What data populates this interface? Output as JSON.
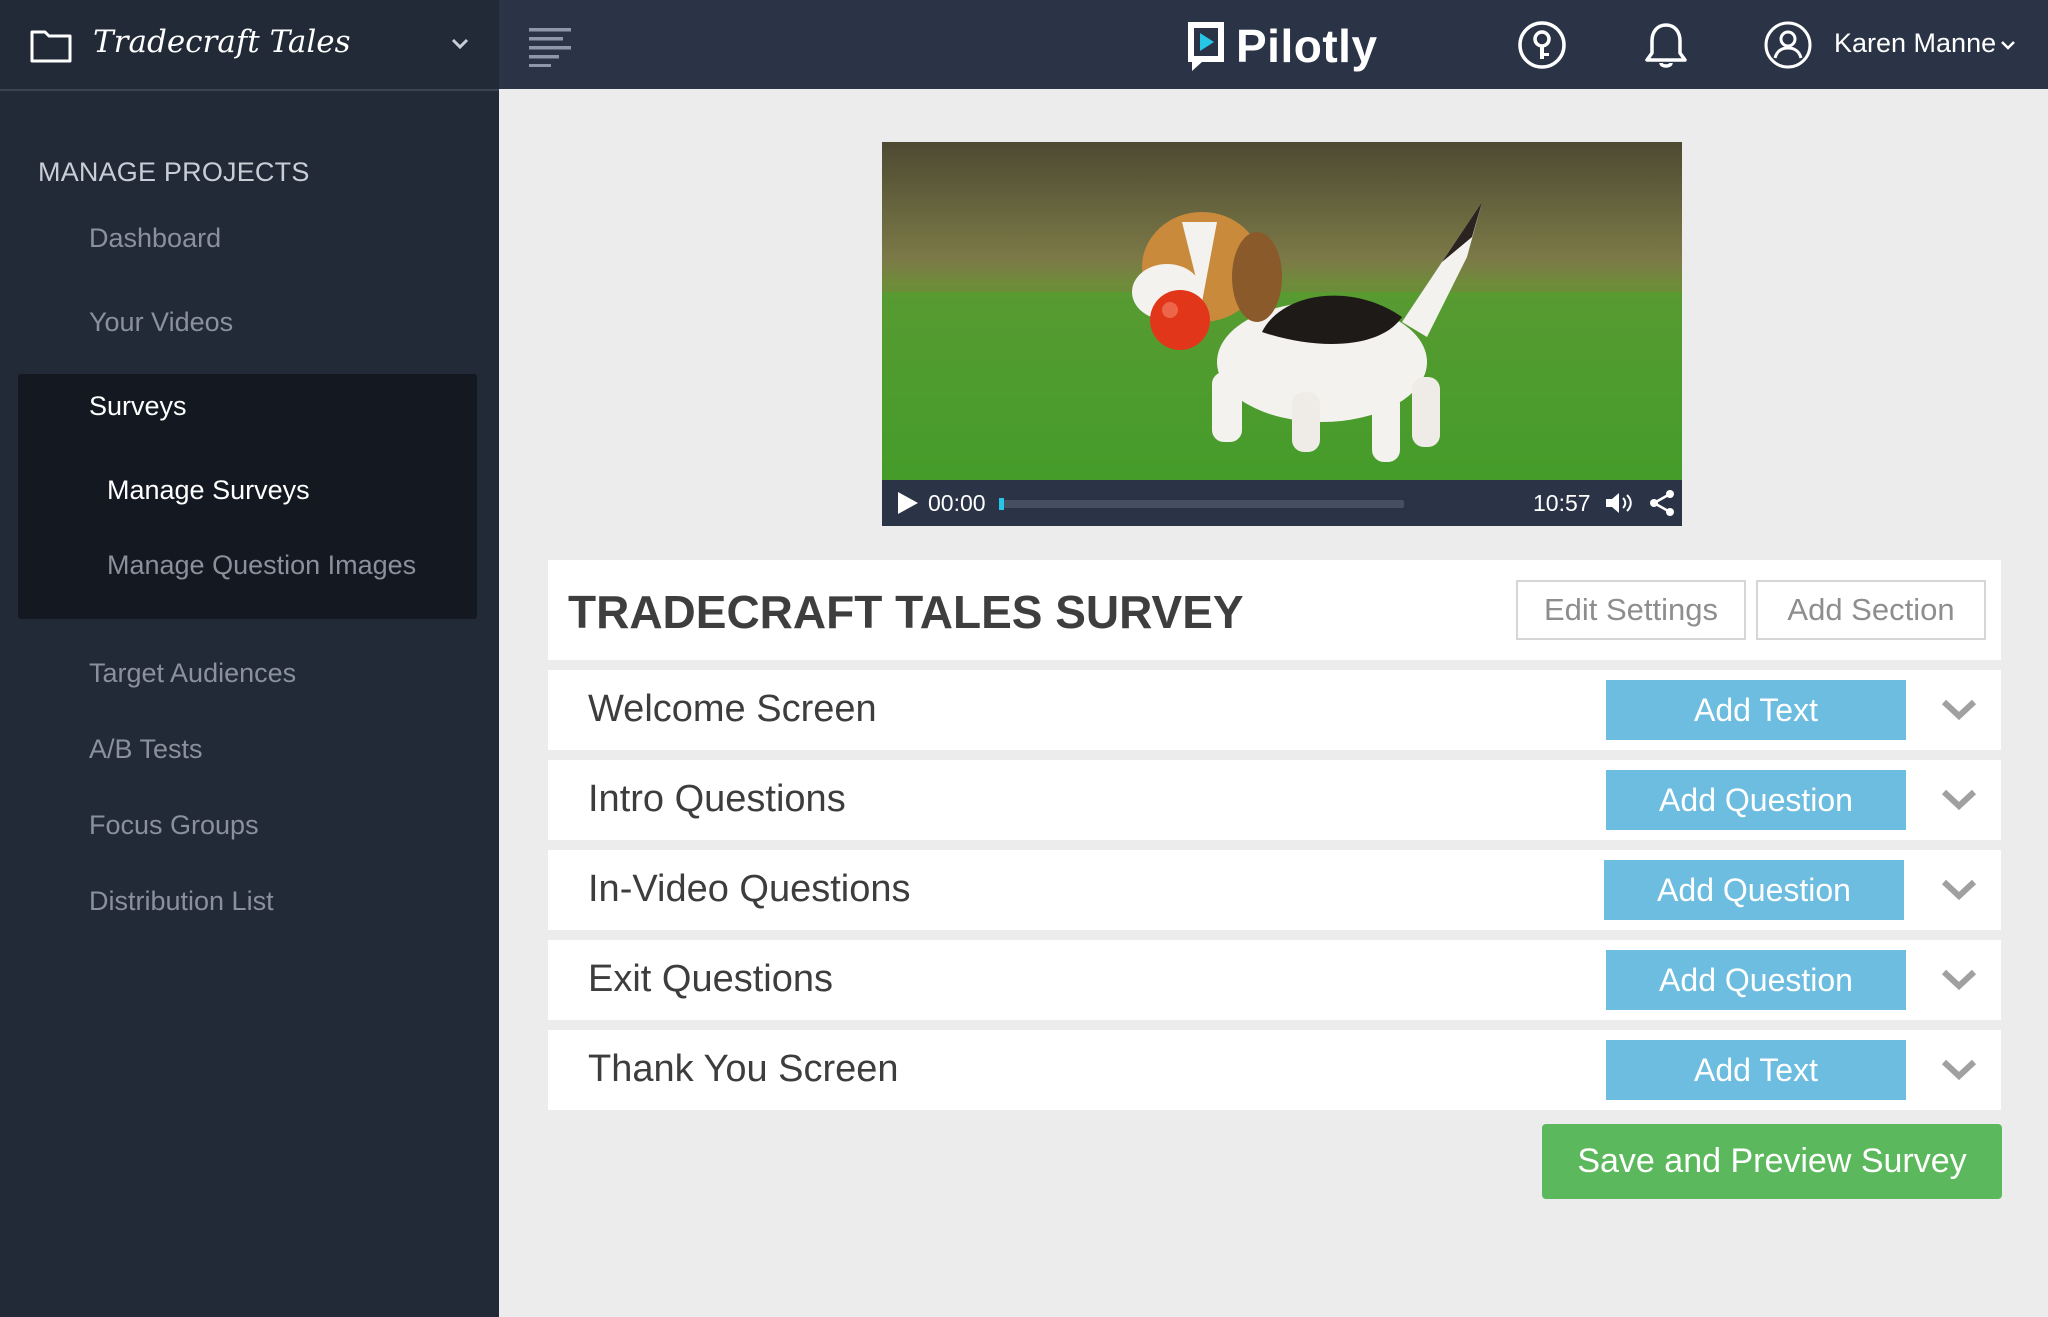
{
  "sidebar": {
    "project_name": "Tradecraft Tales",
    "section_heading": "MANAGE PROJECTS",
    "items": [
      {
        "label": "Dashboard"
      },
      {
        "label": "Your Videos"
      },
      {
        "label": "Surveys"
      },
      {
        "label": "Manage Surveys"
      },
      {
        "label": "Manage Question Images"
      },
      {
        "label": "Target Audiences"
      },
      {
        "label": "A/B Tests"
      },
      {
        "label": "Focus Groups"
      },
      {
        "label": "Distribution List"
      }
    ]
  },
  "header": {
    "logo_text": "Pilotly",
    "user_name": "Karen Manne",
    "icons": [
      "menu-icon",
      "help-icon",
      "bell-icon",
      "user-icon"
    ]
  },
  "video": {
    "current_time": "00:00",
    "total_time": "10:57",
    "progress": 0
  },
  "survey": {
    "title": "TRADECRAFT TALES SURVEY",
    "edit_settings_label": "Edit Settings",
    "add_section_label": "Add Section",
    "sections": [
      {
        "name": "Welcome Screen",
        "button": "Add Text"
      },
      {
        "name": "Intro Questions",
        "button": "Add Question"
      },
      {
        "name": "In-Video Questions",
        "button": "Add Question"
      },
      {
        "name": "Exit Questions",
        "button": "Add Question"
      },
      {
        "name": "Thank You Screen",
        "button": "Add Text"
      }
    ],
    "save_label": "Save and Preview Survey"
  },
  "colors": {
    "sidebar_bg": "#222a37",
    "topbar_bg": "#2a3446",
    "accent_blue": "#6dbde0",
    "accent_green": "#5cb85c",
    "progress_cyan": "#28c6e6"
  }
}
